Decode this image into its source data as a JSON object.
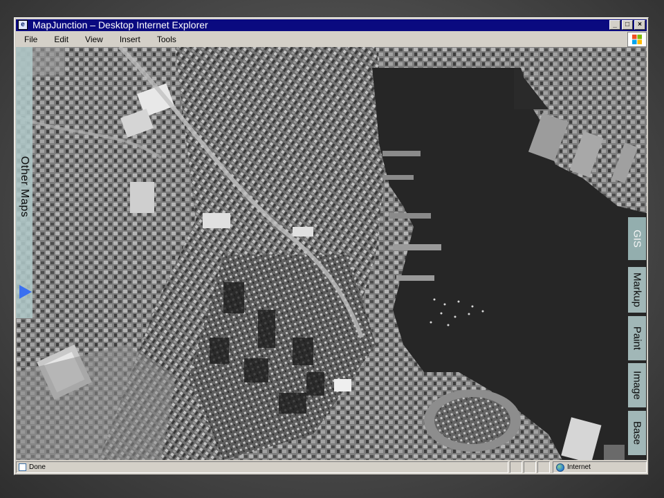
{
  "window": {
    "title": "MapJunction – Desktop  Internet Explorer",
    "buttons": {
      "minimize": "_",
      "maximize": "□",
      "close": "×"
    }
  },
  "menu": [
    "File",
    "Edit",
    "View",
    "Insert",
    "Tools"
  ],
  "map": {
    "imagery": "aerial-grayscale-harbor",
    "colors": {
      "water": "#2b2b2b",
      "land": "#8a8a8a",
      "panel": "#afc8c8",
      "arrow": "#3a6ff0"
    }
  },
  "left_panel": {
    "label": "Other Maps",
    "arrow_icon": "play-right-icon"
  },
  "side_tabs": {
    "gis": "GIS",
    "markup": "Markup",
    "paint": "Paint",
    "image": "Image",
    "base": "Base"
  },
  "status": {
    "text": "Done",
    "zone": "Internet"
  }
}
